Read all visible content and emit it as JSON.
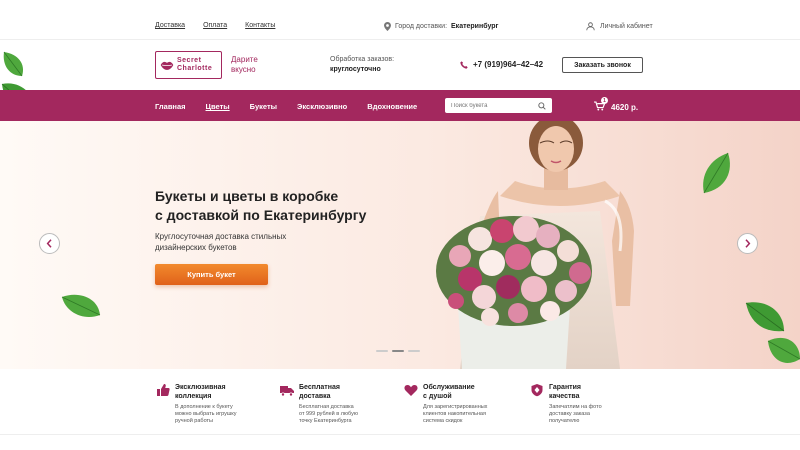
{
  "topbar": {
    "links": [
      "Доставка",
      "Оплата",
      "Контакты"
    ],
    "city_label": "Город доставки:",
    "city_value": "Екатеринбург",
    "cabinet": "Личный кабинет"
  },
  "header": {
    "logo_line1": "Secret",
    "logo_line2": "Charlotte",
    "tagline_line1": "Дарите",
    "tagline_line2": "вкусно",
    "orders_label": "Обработка заказов:",
    "orders_value": "круглосуточно",
    "phone": "+7 (919)964–42–42",
    "callback_button": "Заказать звонок"
  },
  "nav": {
    "items": [
      "Главная",
      "Цветы",
      "Букеты",
      "Эксклюзивно",
      "Вдохновение"
    ],
    "active_index": 1,
    "search_placeholder": "Поиск букета",
    "cart_count": "1",
    "cart_total": "4620 р."
  },
  "hero": {
    "title_line1": "Букеты и цветы в коробке",
    "title_line2": "с доставкой по Екатеринбургу",
    "subtitle_line1": "Круглосуточная доставка стильных",
    "subtitle_line2": "дизайнерских букетов",
    "buy_button": "Купить букет",
    "slides": 3,
    "active_slide": 2
  },
  "features": [
    {
      "icon": "thumbs-up-icon",
      "title1": "Эксклюзивная",
      "title2": "коллекция",
      "desc1": "В дополнение к букету",
      "desc2": "можно выбрать игрушку",
      "desc3": "ручной работы"
    },
    {
      "icon": "truck-icon",
      "title1": "Бесплатная",
      "title2": "доставка",
      "desc1": "Бесплатная доставка",
      "desc2": "от 999 рублей в любую",
      "desc3": "точку Екатеринбурга"
    },
    {
      "icon": "heart-icon",
      "title1": "Обслуживание",
      "title2": "с душой",
      "desc1": "Для зарегистрированных",
      "desc2": "клиентов накопительная",
      "desc3": "система скидок"
    },
    {
      "icon": "shield-icon",
      "title1": "Гарантия",
      "title2": "качества",
      "desc1": "Запечатлим на фото",
      "desc2": "доставку заказа",
      "desc3": "получателю"
    }
  ],
  "colors": {
    "brand": "#a3285e",
    "button": "#ec7a24"
  }
}
